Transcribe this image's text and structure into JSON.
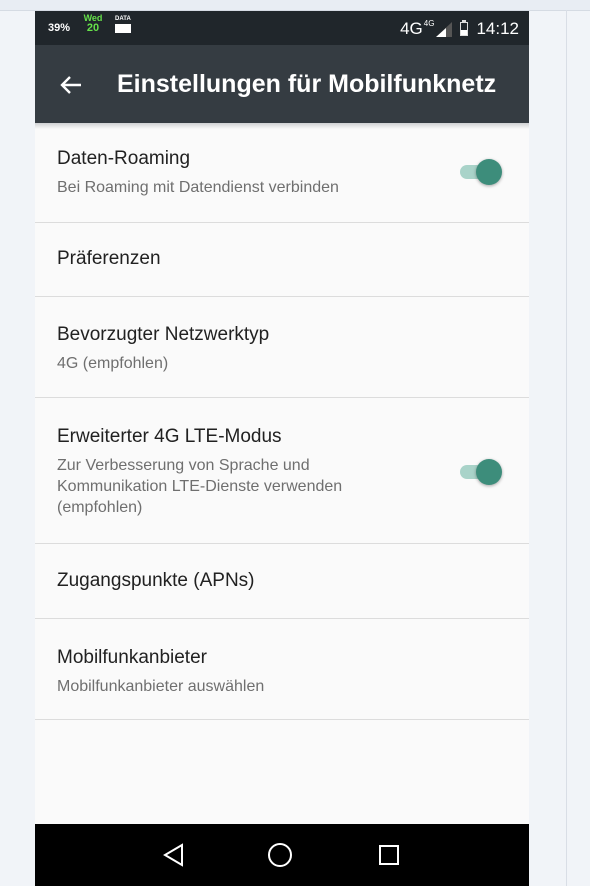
{
  "status_bar": {
    "battery_percent": "39%",
    "date_day": "Wed",
    "date_num": "20",
    "data_label": "DATA",
    "network": "4G",
    "network_sup": "4G",
    "time": "14:12"
  },
  "toolbar": {
    "back_icon": "arrow-back-icon",
    "title": "Einstellungen für Mobilfunknetz"
  },
  "settings": {
    "items": [
      {
        "title": "Daten-Roaming",
        "subtitle": "Bei Roaming mit Datendienst verbinden",
        "toggle": true,
        "toggle_on": true
      },
      {
        "title": "Präferenzen"
      },
      {
        "title": "Bevorzugter Netzwerktyp",
        "subtitle": "4G (empfohlen)"
      },
      {
        "title": "Erweiterter 4G LTE-Modus",
        "subtitle": "Zur Verbesserung von Sprache und Kommunikation LTE-Dienste verwenden (empfohlen)",
        "toggle": true,
        "toggle_on": true
      },
      {
        "title": "Zugangspunkte (APNs)"
      },
      {
        "title": "Mobilfunkanbieter",
        "subtitle": "Mobilfunkanbieter auswählen"
      }
    ]
  },
  "nav_bar": {
    "back": "nav-back-icon",
    "home": "nav-home-icon",
    "recents": "nav-recents-icon"
  },
  "colors": {
    "status_bar": "#20262b",
    "toolbar": "#353c42",
    "switch_thumb": "#3d8d7b",
    "switch_track": "#a9d3c9",
    "background": "#fafafa"
  }
}
